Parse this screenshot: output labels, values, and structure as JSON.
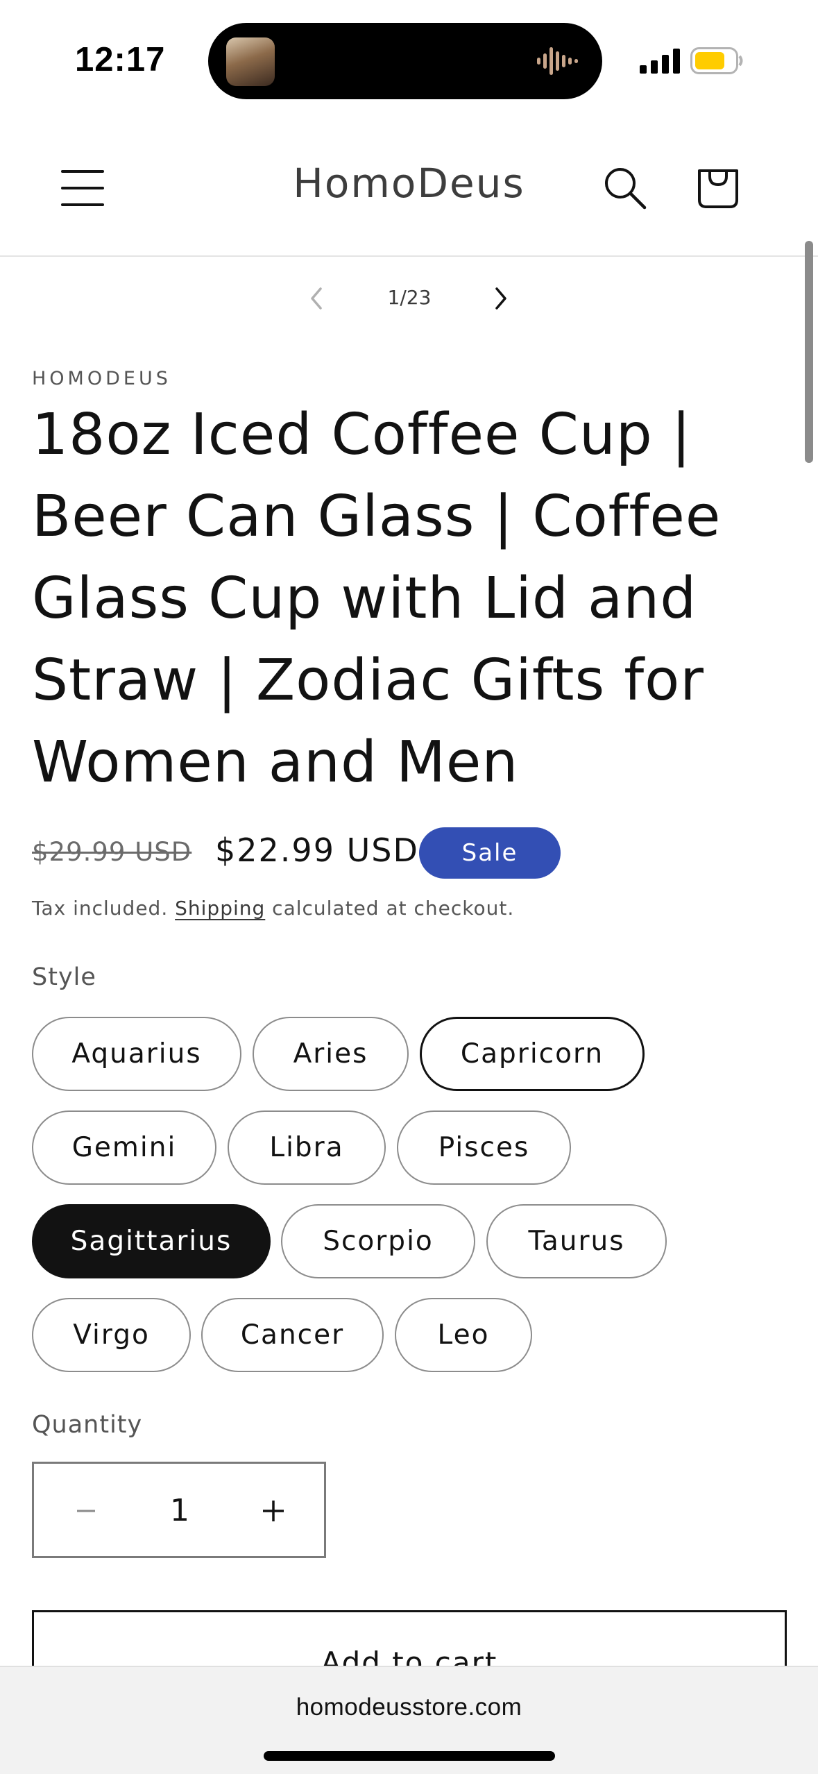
{
  "status_bar": {
    "time": "12:17"
  },
  "header": {
    "brand": "HomoDeus"
  },
  "pager": {
    "count": "1/23"
  },
  "product": {
    "vendor": "HOMODEUS",
    "title": "18oz Iced Coffee Cup | Beer Can Glass | Coffee Glass Cup with Lid and Straw | Zodiac Gifts for Women and Men",
    "price_compare": "$29.99 USD",
    "price_sale": "$22.99 USD",
    "sale_badge": "Sale",
    "tax_before": "Tax included. ",
    "tax_link": "Shipping",
    "tax_after": " calculated at checkout.",
    "style_label": "Style",
    "styles": [
      "Aquarius",
      "Aries",
      "Capricorn",
      "Gemini",
      "Libra",
      "Pisces",
      "Sagittarius",
      "Scorpio",
      "Taurus",
      "Virgo",
      "Cancer",
      "Leo"
    ],
    "selected_style": "Sagittarius",
    "quantity_label": "Quantity",
    "quantity": "1",
    "add_to_cart": "Add to cart"
  },
  "browser": {
    "url": "homodeusstore.com"
  },
  "colors": {
    "accent": "#334fb4",
    "text": "#121212",
    "battery": "#ffcc00"
  }
}
